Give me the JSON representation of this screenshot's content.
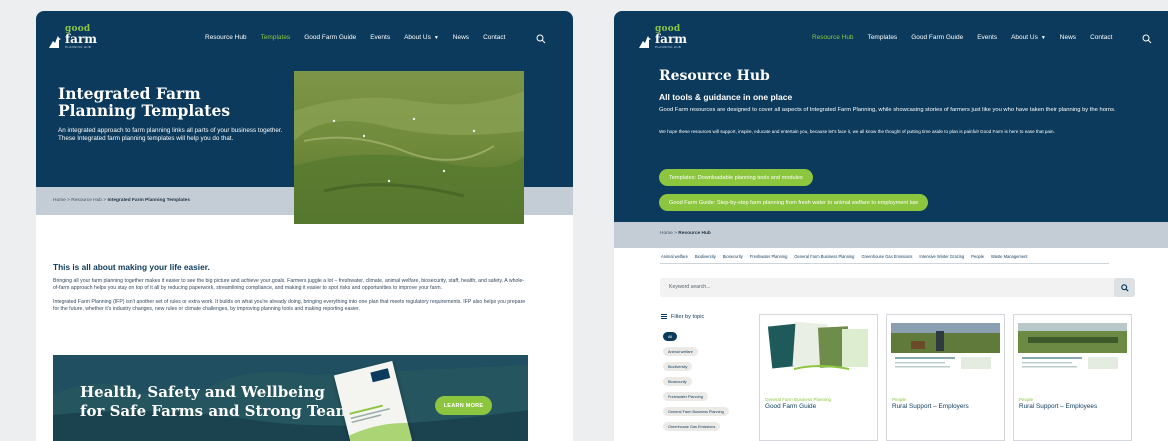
{
  "brand": {
    "logo_top": "good",
    "logo_main": "farm",
    "logo_sub": "PLANNING HUB",
    "accent": "#8cc63f",
    "navy": "#0c3a5c"
  },
  "left": {
    "nav": [
      {
        "label": "Resource Hub"
      },
      {
        "label": "Templates",
        "active": true
      },
      {
        "label": "Good Farm Guide"
      },
      {
        "label": "Events"
      },
      {
        "label": "About Us",
        "dropdown": true
      },
      {
        "label": "News"
      },
      {
        "label": "Contact"
      }
    ],
    "hero": {
      "title": "Integrated Farm Planning Templates",
      "description": "An integrated approach to farm planning links all parts of your business together. These Integrated farm planning templates will help you do that."
    },
    "breadcrumb": {
      "home": "Home",
      "sep": ">",
      "section": "Resource Hub",
      "current": "Integrated Farm Planning Templates"
    },
    "body": {
      "heading": "This is all about making your life easier.",
      "p1": "Bringing all your farm planning together makes it easier to see the big picture and achieve your goals. Farmers juggle a lot – freshwater, climate, animal welfare, biosecurity, staff, health, and safety. A whole-of-farm approach helps you stay on top of it all by reducing paperwork, streamlining compliance, and making it easier to spot risks and opportunities to improve your farm.",
      "p2": "Integrated Farm Planning (IFP) isn't another set of rules or extra work. It builds on what you're already doing, bringing everything into one plan that meets regulatory requirements. IFP also helps you prepare for the future, whether it's industry changes, new rules or climate challenges, by improving planning tools and making reporting easier."
    },
    "banner": {
      "title_line1": "Health, Safety and Wellbeing",
      "title_line2": "for Safe Farms and Strong Teams",
      "button": "LEARN MORE"
    }
  },
  "right": {
    "nav": [
      {
        "label": "Resource Hub",
        "active": true
      },
      {
        "label": "Templates"
      },
      {
        "label": "Good Farm Guide"
      },
      {
        "label": "Events"
      },
      {
        "label": "About Us",
        "dropdown": true
      },
      {
        "label": "News"
      },
      {
        "label": "Contact"
      }
    ],
    "hero": {
      "title": "Resource Hub",
      "subtitle": "All tools & guidance in one place",
      "p1": "Good Farm resources are designed to cover all aspects of Integrated Farm Planning, while showcasing stories of farmers just like you who have taken their planning by the horns.",
      "p2": "We hope these resources will support, inspire, educate and entertain you, because let's face it, we all know the thought of putting time aside to plan is painful! Good Farm is here to ease that pain.",
      "pill1": "Templates: Downloadable planning tools and modules",
      "pill2": "Good Farm Guide: Step-by-step farm planning from fresh water to animal welfare to employment law"
    },
    "breadcrumb": {
      "home": "Home",
      "sep": ">",
      "current": "Resource Hub"
    },
    "topics": [
      "Animal welfare",
      "Biodiversity",
      "Biosecurity",
      "Freshwater Planning",
      "General Farm Business Planning",
      "Greenhouse Gas Emissions",
      "Intensive Winter Grazing",
      "People",
      "Waste Management"
    ],
    "search": {
      "placeholder": "Keyword search..."
    },
    "filter": {
      "heading": "Filter by topic",
      "tags": [
        "All",
        "Animal welfare",
        "Biodiversity",
        "Biosecurity",
        "Freshwater Planning",
        "General Farm Business Planning",
        "Greenhouse Gas Emissions"
      ]
    },
    "cards": [
      {
        "category": "General Farm Business Planning",
        "title": "Good Farm Guide"
      },
      {
        "category": "People",
        "title": "Rural Support – Employers"
      },
      {
        "category": "People",
        "title": "Rural Support – Employees"
      }
    ]
  }
}
